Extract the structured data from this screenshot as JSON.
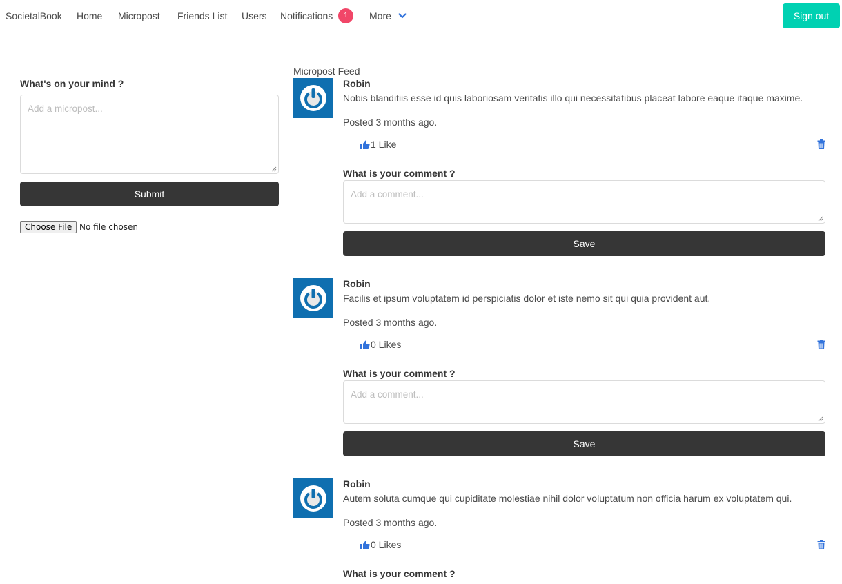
{
  "nav": {
    "brand": "SocietalBook",
    "home": "Home",
    "micropost": "Micropost",
    "friends": "Friends List",
    "users": "Users",
    "notifications": "Notifications",
    "notification_count": "1",
    "more": "More",
    "signout": "Sign out"
  },
  "composer": {
    "label": "What's on your mind ?",
    "placeholder": "Add a micropost...",
    "submit": "Submit",
    "file_button": "Choose File",
    "file_status": "No file chosen"
  },
  "feed": {
    "title": "Micropost Feed",
    "comment_label": "What is your comment ?",
    "comment_placeholder": "Add a comment...",
    "save_label": "Save",
    "posts": [
      {
        "author": "Robin",
        "content": "Nobis blanditiis esse id quis laboriosam veritatis illo qui necessitatibus placeat labore eaque itaque maxime.",
        "posted": "Posted 3 months ago.",
        "likes": "1 Like"
      },
      {
        "author": "Robin",
        "content": "Facilis et ipsum voluptatem id perspiciatis dolor et iste nemo sit qui quia provident aut.",
        "posted": "Posted 3 months ago.",
        "likes": "0 Likes"
      },
      {
        "author": "Robin",
        "content": "Autem soluta cumque qui cupiditate molestiae nihil dolor voluptatum non officia harum ex voluptatem qui.",
        "posted": "Posted 3 months ago.",
        "likes": "0 Likes"
      }
    ]
  },
  "colors": {
    "primary": "#00d1b2",
    "dark": "#363636",
    "badge": "#f14668",
    "link_icon": "#3273dc",
    "avatar_bg": "#0f6fb0"
  }
}
